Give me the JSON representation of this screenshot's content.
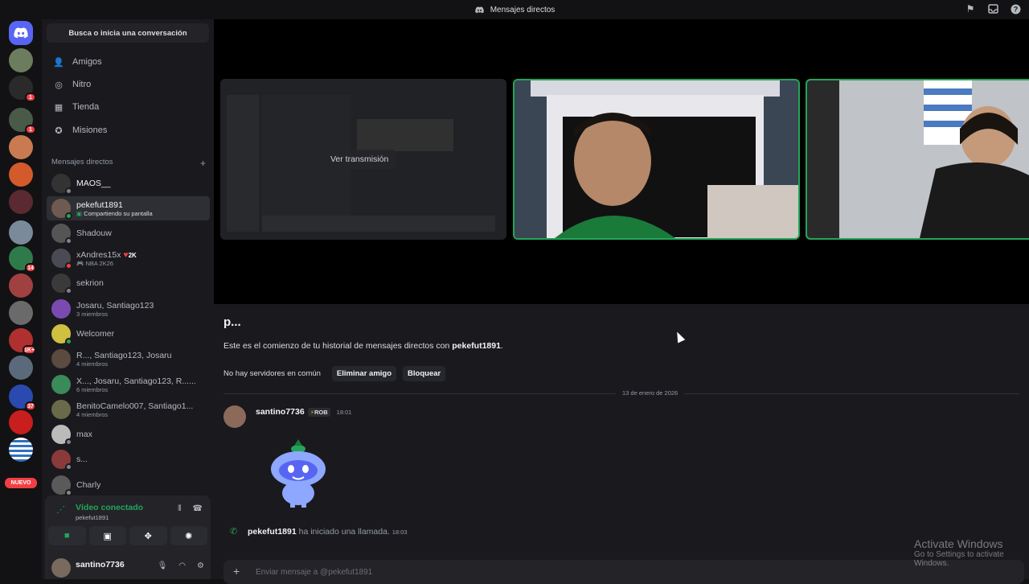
{
  "titlebar": {
    "title": "Mensajes directos"
  },
  "rail": {
    "badges": [
      "1",
      "1",
      "14",
      "1K+",
      "37"
    ],
    "nuevo": "NUEVO"
  },
  "dms": {
    "search_placeholder": "Busca o inicia una conversación",
    "nav": [
      "Amigos",
      "Nitro",
      "Tienda",
      "Misiones"
    ],
    "header": "Mensajes directos",
    "add": "+",
    "items": [
      {
        "name": "MAOS__",
        "sub": ""
      },
      {
        "name": "pekefut1891",
        "sub": "Compartiendo su pantalla"
      },
      {
        "name": "Shadouw",
        "sub": ""
      },
      {
        "name": "xAndres15x",
        "sub": "NBA 2K26",
        "badge": "2K"
      },
      {
        "name": "sekrion",
        "sub": ""
      },
      {
        "name": "Josaru, Santiago123",
        "sub": "3 miembros"
      },
      {
        "name": "Welcomer",
        "sub": ""
      },
      {
        "name": "R..., Santiago123, Josaru",
        "sub": "4 miembros"
      },
      {
        "name": "X..., Josaru, Santiago123, R......",
        "sub": "6 miembros"
      },
      {
        "name": "BenitoCamelo007, Santiago1...",
        "sub": "4 miembros"
      },
      {
        "name": "max",
        "sub": ""
      },
      {
        "name": "s...",
        "sub": ""
      },
      {
        "name": "Charly",
        "sub": ""
      }
    ]
  },
  "voice": {
    "status": "Vídeo conectado",
    "channel": "pekefut1891"
  },
  "user": {
    "name": "santino7736"
  },
  "call": {
    "view_stream": "Ver transmisión"
  },
  "chat": {
    "truncated_name": "p...",
    "intro_prefix": "Este es el comienzo de tu historial de mensajes directos con ",
    "intro_user": "pekefut1891",
    "intro_suffix": ".",
    "no_servers": "No hay servidores en común",
    "remove_friend": "Eliminar amigo",
    "block": "Bloquear",
    "date": "13 de enero de 2026",
    "message": {
      "author": "santino7736",
      "tag": "ROB",
      "time": "18:01"
    },
    "call_event": {
      "user": "pekefut1891",
      "text": "ha iniciado una llamada.",
      "time": "18:03"
    },
    "composer_placeholder": "Enviar mensaje a @pekefut1891"
  },
  "watermark": {
    "line1": "Activate Windows",
    "line2": "Go to Settings to activate Windows."
  },
  "colors": {
    "accent_green": "#23a55a",
    "badge_red": "#f23f43",
    "blurple": "#5865f2"
  }
}
